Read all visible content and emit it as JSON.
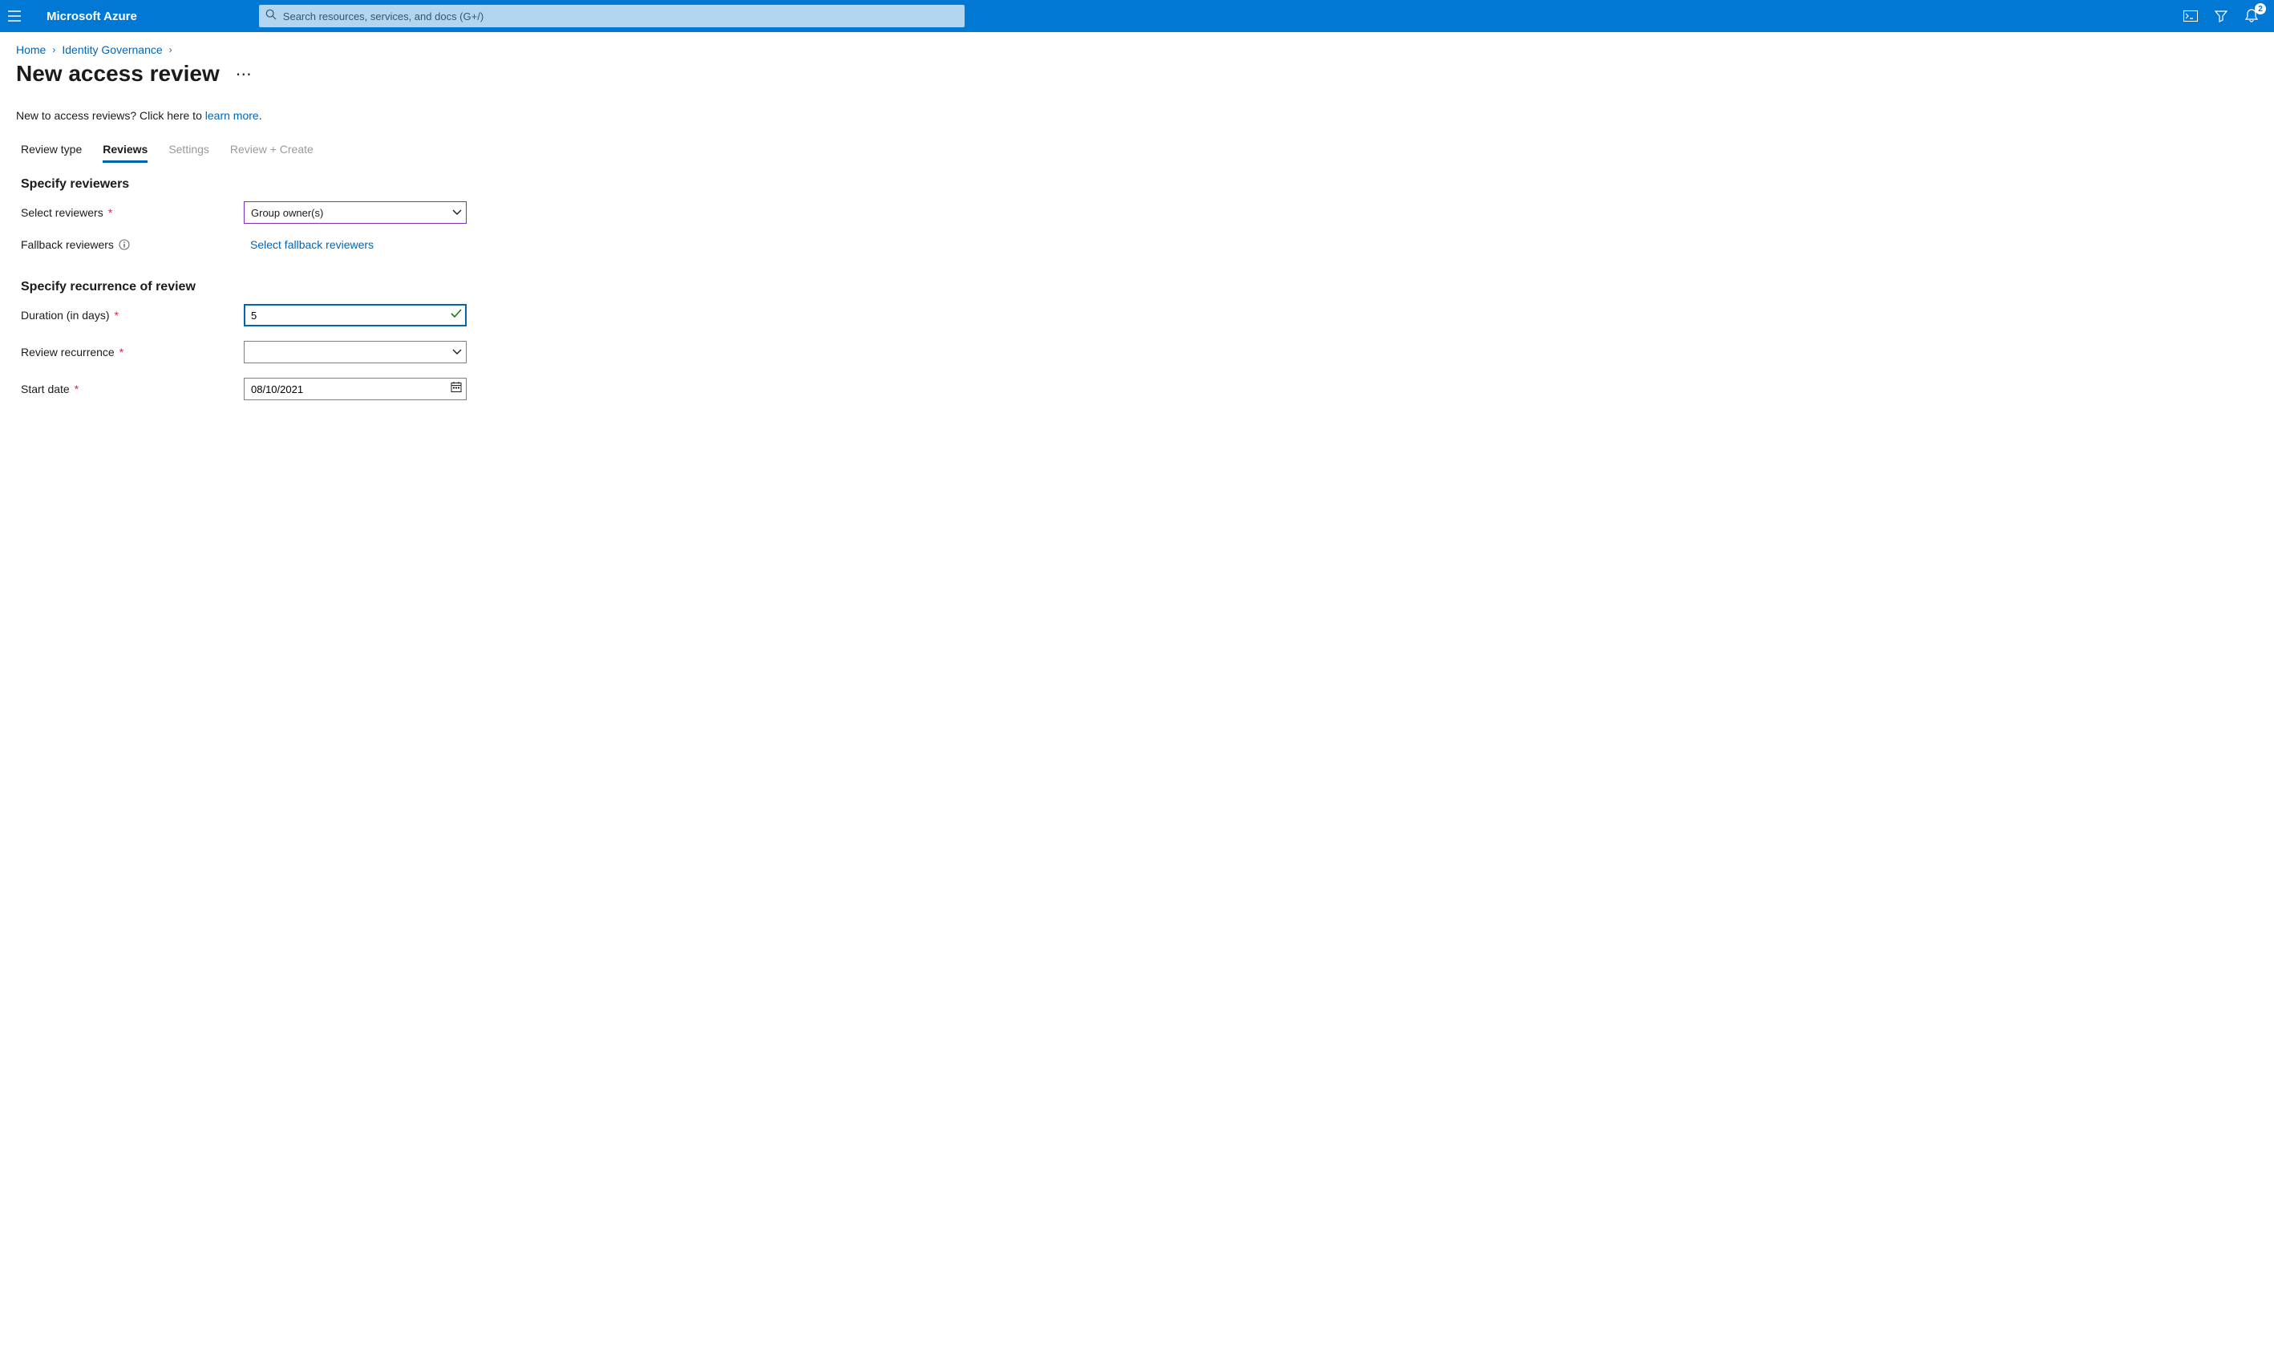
{
  "header": {
    "brand": "Microsoft Azure",
    "search_placeholder": "Search resources, services, and docs (G+/)",
    "notification_count": "2"
  },
  "breadcrumb": {
    "home": "Home",
    "identity_governance": "Identity Governance"
  },
  "page": {
    "title": "New access review",
    "intro_prefix": "New to access reviews? Click here to ",
    "intro_link": "learn more",
    "intro_suffix": "."
  },
  "tabs": {
    "review_type": "Review type",
    "reviews": "Reviews",
    "settings": "Settings",
    "review_create": "Review + Create"
  },
  "specify_reviewers": {
    "heading": "Specify reviewers",
    "select_reviewers_label": "Select reviewers",
    "select_reviewers_value": "Group owner(s)",
    "fallback_label": "Fallback reviewers",
    "fallback_action": "Select fallback reviewers"
  },
  "recurrence": {
    "heading": "Specify recurrence of review",
    "duration_label": "Duration (in days)",
    "duration_value": "5",
    "recurrence_label": "Review recurrence",
    "recurrence_value": "",
    "start_date_label": "Start date",
    "start_date_value": "08/10/2021"
  }
}
